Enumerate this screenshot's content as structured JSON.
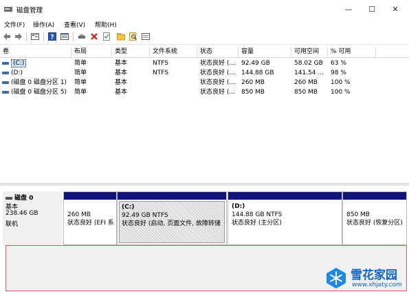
{
  "window": {
    "title": "磁盘管理",
    "minimize": "—",
    "maximize": "☐",
    "close": "✕"
  },
  "menu": [
    "文件(F)",
    "操作(A)",
    "查看(V)",
    "帮助(H)"
  ],
  "toolbar_icons": [
    "back-icon",
    "forward-icon",
    "list-view-icon",
    "help-icon",
    "properties-icon",
    "connect-drive-icon",
    "delete-icon",
    "check-icon",
    "folder-icon",
    "search-icon",
    "settings-icon"
  ],
  "volume_table": {
    "headers": [
      "卷",
      "布局",
      "类型",
      "文件系统",
      "状态",
      "容量",
      "可用空间",
      "% 可用"
    ],
    "rows": [
      {
        "name": "(C:)",
        "layout": "简单",
        "type": "基本",
        "fs": "NTFS",
        "status": "状态良好 (...",
        "capacity": "92.49 GB",
        "free": "58.02 GB",
        "pct": "63 %"
      },
      {
        "name": "(D:)",
        "layout": "简单",
        "type": "基本",
        "fs": "NTFS",
        "status": "状态良好 (...",
        "capacity": "144.88 GB",
        "free": "141.54 ...",
        "pct": "98 %"
      },
      {
        "name": "(磁盘 0 磁盘分区 1)",
        "layout": "简单",
        "type": "基本",
        "fs": "",
        "status": "状态良好 (...",
        "capacity": "260 MB",
        "free": "260 MB",
        "pct": "100 %"
      },
      {
        "name": "(磁盘 0 磁盘分区 5)",
        "layout": "简单",
        "type": "基本",
        "fs": "",
        "status": "状态良好 (...",
        "capacity": "850 MB",
        "free": "850 MB",
        "pct": "100 %"
      }
    ]
  },
  "disk": {
    "name": "磁盘 0",
    "type": "基本",
    "size": "238.46 GB",
    "status": "联机"
  },
  "partitions": [
    {
      "label": "",
      "size": "260 MB",
      "status": "状态良好 (EFI 系"
    },
    {
      "label": "(C:)",
      "size": "92.49 GB NTFS",
      "status": "状态良好 (启动, 页面文件, 故障转储"
    },
    {
      "label": "(D:)",
      "size": "144.88 GB NTFS",
      "status": "状态良好 (主分区)"
    },
    {
      "label": "",
      "size": "850 MB",
      "status": "状态良好 (恢复分区)"
    }
  ],
  "watermark": {
    "name": "雪花家园",
    "url": "www.xhjaty.com"
  },
  "colors": {
    "partition_bar": "#11127a",
    "highlight_border": "#e05454",
    "watermark": "#1565c0"
  }
}
